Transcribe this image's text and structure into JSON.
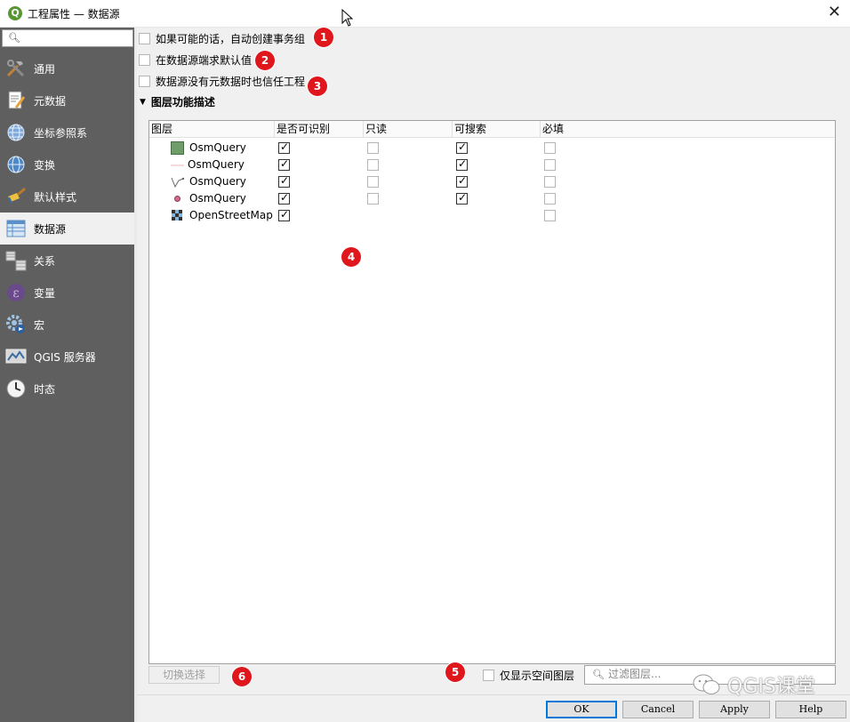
{
  "window": {
    "app_icon": "Q",
    "title": "工程属性 — 数据源",
    "close": "✕"
  },
  "sidebar": {
    "search_placeholder": "",
    "items": [
      {
        "label": "通用",
        "icon": "tools-icon"
      },
      {
        "label": "元数据",
        "icon": "metadata-icon"
      },
      {
        "label": "坐标参照系",
        "icon": "crs-globe-icon"
      },
      {
        "label": "变换",
        "icon": "transform-globe-icon"
      },
      {
        "label": "默认样式",
        "icon": "paintbrush-icon"
      },
      {
        "label": "数据源",
        "icon": "datasource-table-icon"
      },
      {
        "label": "关系",
        "icon": "relations-icon"
      },
      {
        "label": "变量",
        "icon": "variables-icon"
      },
      {
        "label": "宏",
        "icon": "macro-gear-icon"
      },
      {
        "label": "QGIS 服务器",
        "icon": "qgis-server-icon"
      },
      {
        "label": "时态",
        "icon": "clock-icon"
      }
    ],
    "active_index": 5
  },
  "options": {
    "auto_transaction": {
      "label": "如果可能的话，自动创建事务组",
      "checked": false
    },
    "eval_defaults": {
      "label": "在数据源端求默认值",
      "checked": false
    },
    "trust_project": {
      "label": "数据源没有元数据时也信任工程",
      "checked": false
    }
  },
  "section": {
    "title": "图层功能描述",
    "expanded": true
  },
  "table": {
    "columns": [
      "图层",
      "是否可识别",
      "只读",
      "可搜索",
      "必填"
    ],
    "rows": [
      {
        "name": "OsmQuery",
        "icon": "polygon-layer-icon",
        "identifiable": true,
        "readonly": false,
        "searchable": true,
        "required": false,
        "has_readonly": true,
        "has_searchable": true
      },
      {
        "name": "OsmQuery",
        "icon": "line-layer-icon",
        "identifiable": true,
        "readonly": false,
        "searchable": true,
        "required": false,
        "has_readonly": true,
        "has_searchable": true
      },
      {
        "name": "OsmQuery",
        "icon": "multiline-layer-icon",
        "identifiable": true,
        "readonly": false,
        "searchable": true,
        "required": false,
        "has_readonly": true,
        "has_searchable": true
      },
      {
        "name": "OsmQuery",
        "icon": "point-layer-icon",
        "identifiable": true,
        "readonly": false,
        "searchable": true,
        "required": false,
        "has_readonly": true,
        "has_searchable": true
      },
      {
        "name": "OpenStreetMap",
        "icon": "raster-layer-icon",
        "identifiable": true,
        "readonly": null,
        "searchable": null,
        "required": false,
        "has_readonly": false,
        "has_searchable": false
      }
    ]
  },
  "annotations": [
    "1",
    "2",
    "3",
    "4",
    "5",
    "6"
  ],
  "bottom": {
    "toggle_selection": "切换选择",
    "spatial_only": {
      "label": "仅显示空间图层",
      "checked": false
    },
    "filter_placeholder": "过滤图层..."
  },
  "watermark": "QGIS课堂",
  "buttons": {
    "ok": "OK",
    "cancel": "Cancel",
    "apply": "Apply",
    "help": "Help"
  },
  "colors": {
    "sidebar_bg": "#5f5f5f",
    "badge": "#e0161d",
    "qgis_green": "#589632",
    "polygon_fill": "#6f9d6a"
  }
}
